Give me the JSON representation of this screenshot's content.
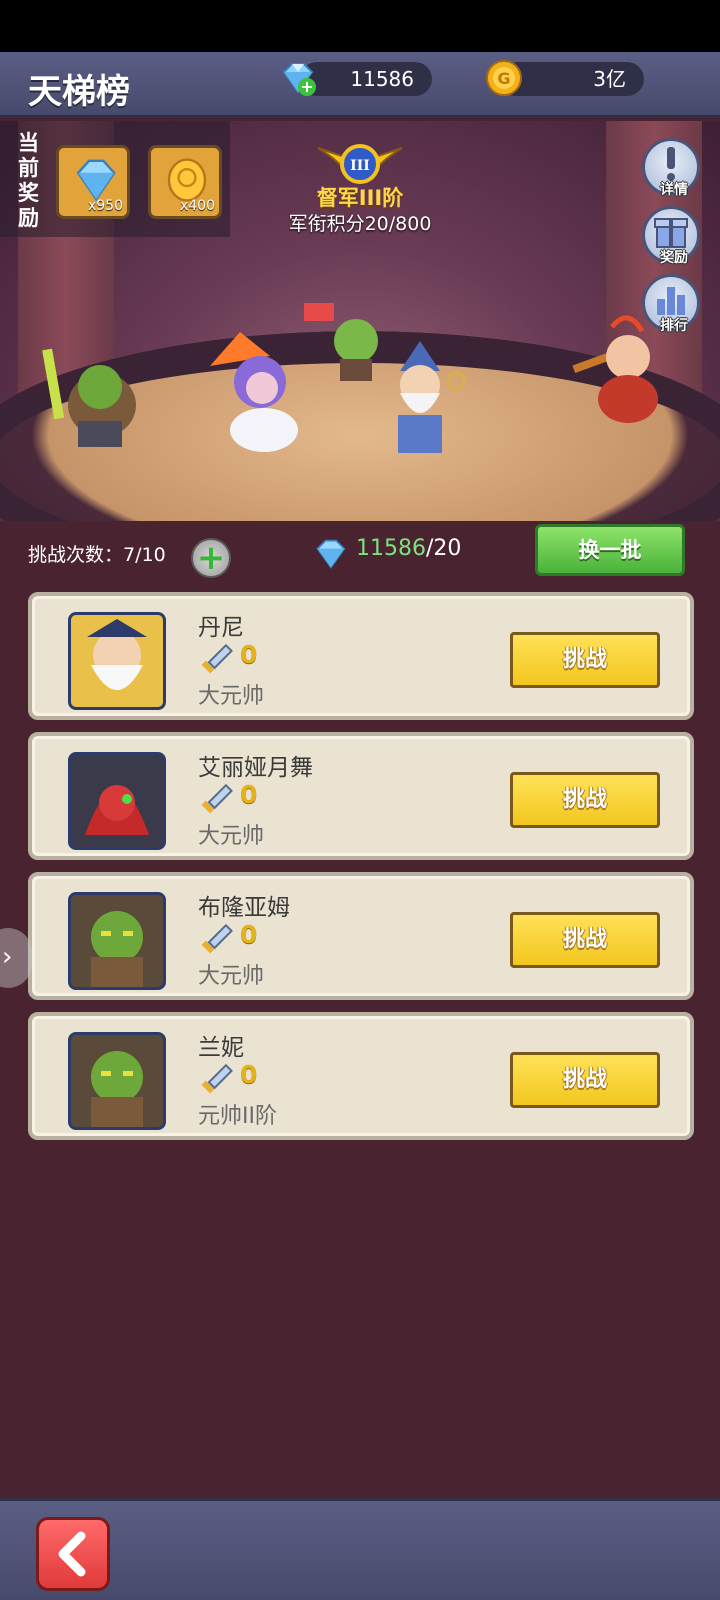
{
  "header": {
    "title": "天梯榜",
    "gem_count": "11586",
    "gold_count": "3亿"
  },
  "rewards": {
    "label": "当前奖励",
    "items": [
      {
        "icon": "diamond-icon",
        "qty": "x950"
      },
      {
        "icon": "gold-coin-icon",
        "qty": "x400"
      }
    ]
  },
  "rank": {
    "badge_numeral": "III",
    "name": "督军III阶",
    "points": "军衔积分20/800"
  },
  "side_buttons": [
    {
      "icon": "exclamation-icon",
      "label": "详情"
    },
    {
      "icon": "gift-icon",
      "label": "奖励"
    },
    {
      "icon": "bar-chart-icon",
      "label": "排行"
    }
  ],
  "challenge": {
    "chances": "挑战次数：7/10",
    "gem_have": "11586",
    "gem_cost": "/20",
    "refresh_label": "换一批"
  },
  "opponents": [
    {
      "name": "丹尼",
      "power": "0",
      "rank": "大元帅",
      "button": "挑战",
      "avatar": "wizard"
    },
    {
      "name": "艾丽娅月舞",
      "power": "0",
      "rank": "大元帅",
      "button": "挑战",
      "avatar": "red-hood"
    },
    {
      "name": "布隆亚姆",
      "power": "0",
      "rank": "大元帅",
      "button": "挑战",
      "avatar": "orc"
    },
    {
      "name": "兰妮",
      "power": "0",
      "rank": "元帅II阶",
      "button": "挑战",
      "avatar": "orc"
    }
  ],
  "colors": {
    "background": "#4a2330",
    "bar": "#525579",
    "card": "#eae3d2",
    "fight_button": "#f5cd28",
    "refresh_button": "#5fc24a",
    "gold_text": "#ffd84a"
  }
}
